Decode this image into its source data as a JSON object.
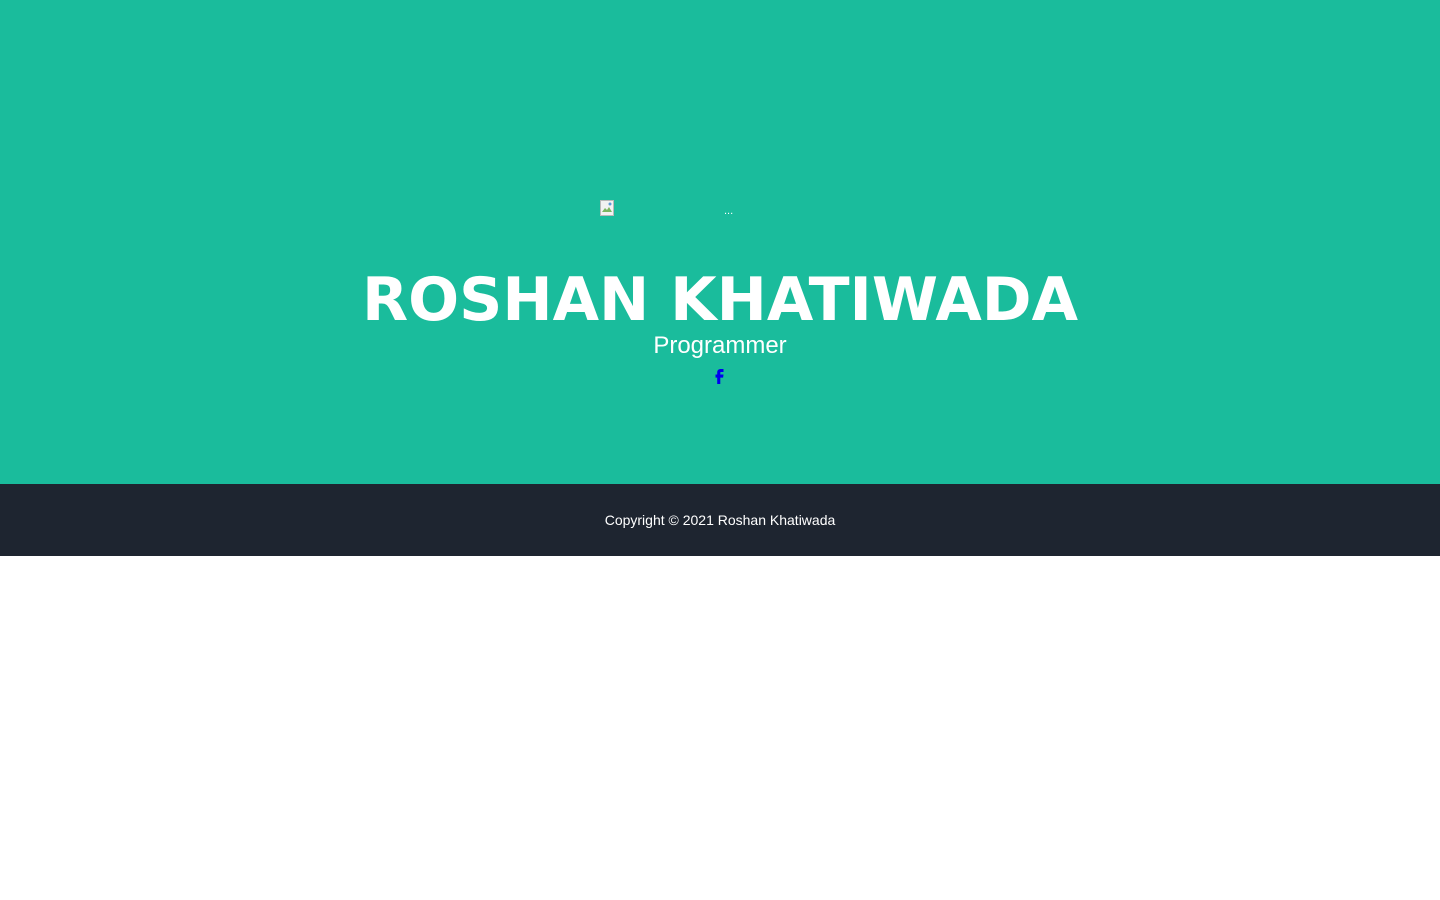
{
  "hero": {
    "avatar_alt": "...",
    "name": "ROSHAN KHATIWADA",
    "subtitle": "Programmer",
    "social_icon": "facebook-icon"
  },
  "footer": {
    "copyright": "Copyright © 2021 Roshan Khatiwada"
  },
  "colors": {
    "hero_background": "#1abc9c",
    "footer_background": "#1e2530",
    "text": "#ffffff",
    "link": "#0000ee"
  }
}
